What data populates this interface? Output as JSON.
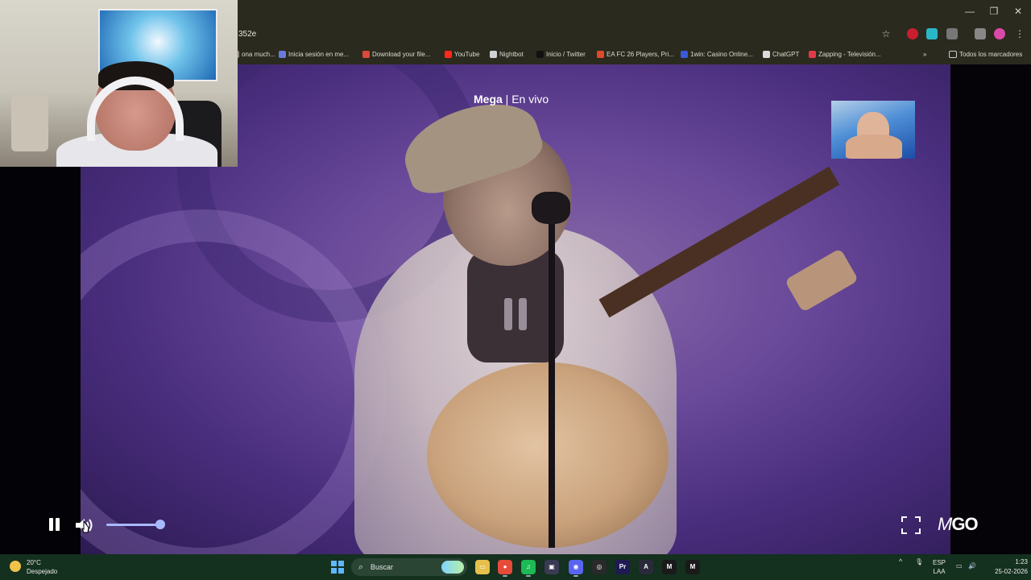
{
  "browser": {
    "url_fragment": "352e",
    "window_controls": {
      "minimize_glyph": "—",
      "restore_glyph": "❐",
      "close_glyph": "✕"
    },
    "bookmarks": [
      {
        "label": "ona much...",
        "color": "#8a8a7a"
      },
      {
        "label": "Inicia sesión en me...",
        "color": "#6a7adc"
      },
      {
        "label": "Download your file...",
        "color": "#d94a3a"
      },
      {
        "label": "YouTube",
        "color": "#ff2a1a"
      },
      {
        "label": "Nightbot",
        "color": "#cfd2d6"
      },
      {
        "label": "Inicio / Twitter",
        "color": "#111111"
      },
      {
        "label": "EA FC 26 Players, Pri...",
        "color": "#e04a2a"
      },
      {
        "label": "1win: Casino Online...",
        "color": "#3a5ad8"
      },
      {
        "label": "ChatGPT",
        "color": "#dcdcdc"
      },
      {
        "label": "Zapping - Televisión...",
        "color": "#e23a4a"
      }
    ],
    "overflow_glyph": "»",
    "all_bookmarks_label": "Todos los marcadores",
    "star_icon": "☆",
    "menu_icon": "⋮"
  },
  "player": {
    "channel_name": "Mega",
    "separator": " | ",
    "channel_status": "En vivo",
    "volume_fraction": 0.98,
    "accent_color": "#a9b9ff",
    "logo_prefix": "M",
    "logo_text": "GO",
    "fullscreen_icon": "fullscreen-icon",
    "pause_icon": "pause-icon",
    "volume_icon": "volume-icon"
  },
  "taskbar": {
    "weather_temp": "20°C",
    "weather_desc": "Despejado",
    "search_icon": "⌕",
    "search_label": "Buscar",
    "apps": [
      {
        "name": "file-explorer",
        "glyph": "▭",
        "bg": "#e6c04a"
      },
      {
        "name": "chrome",
        "glyph": "●",
        "bg": "#e84a3a"
      },
      {
        "name": "spotify",
        "glyph": "♫",
        "bg": "#1db954"
      },
      {
        "name": "app-dark",
        "glyph": "▣",
        "bg": "#3a3a55"
      },
      {
        "name": "discord",
        "glyph": "◉",
        "bg": "#5865f2"
      },
      {
        "name": "obs",
        "glyph": "◎",
        "bg": "#2a2a2a"
      },
      {
        "name": "premiere",
        "glyph": "Pr",
        "bg": "#1f1a54"
      },
      {
        "name": "app-a",
        "glyph": "A",
        "bg": "#2a2a3a"
      },
      {
        "name": "app-m1",
        "glyph": "M",
        "bg": "#1a1a1a"
      },
      {
        "name": "app-m2",
        "glyph": "M",
        "bg": "#1a1a1a"
      }
    ],
    "tray_chevron": "^",
    "mic_icon": "🎙",
    "language": "ESP",
    "keyboard": "LAA",
    "network_icon": "▭",
    "volume_icon": "🔊",
    "time": "1:23",
    "date": "25-02-2026"
  }
}
